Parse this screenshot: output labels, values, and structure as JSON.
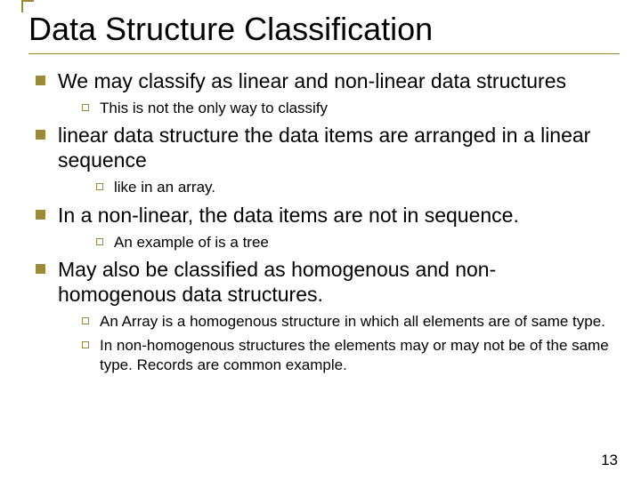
{
  "title": "Data Structure Classification",
  "bullets": {
    "b1": "We may classify as linear and non-linear data structures",
    "b1a": "This is not the only way to classify",
    "b2": "linear data structure the data items are arranged in a linear sequence",
    "b2a": "like in an array.",
    "b3": "In a non-linear, the data items are not in sequence.",
    "b3a": "An example of is a tree",
    "b4": "May also be classified as homogenous and non-homogenous data structures.",
    "b4a": "An Array is a homogenous structure in which all elements are of same type.",
    "b4b": "In non-homogenous structures the elements may or may not be of the same type. Records are common example."
  },
  "page_number": "13"
}
